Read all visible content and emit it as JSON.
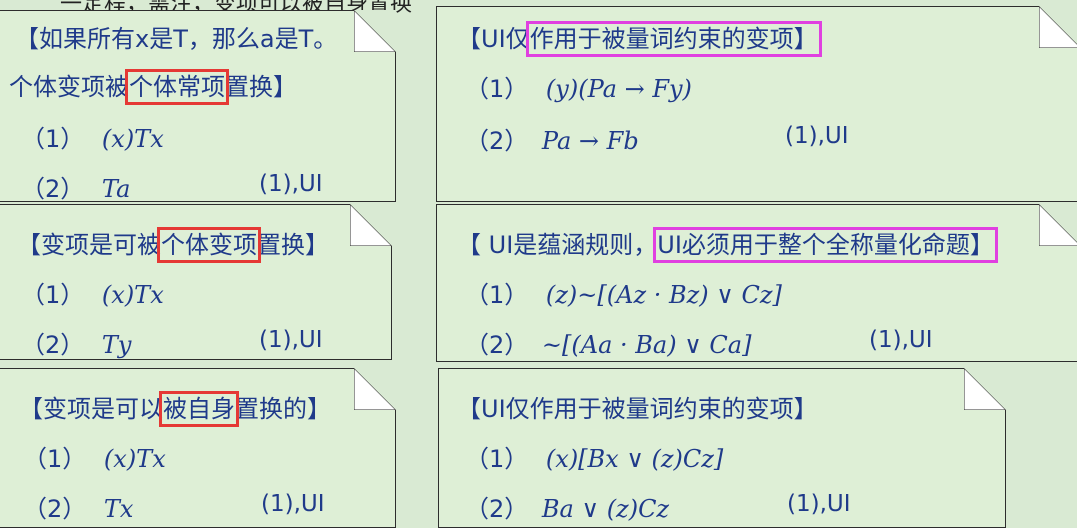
{
  "top_strip": "一定程，需注，变项可以被自身置换",
  "panels": [
    {
      "title_pre": "【如果所有x是T，那么a是T。",
      "title_line2_pre": "个体变项被",
      "title_line2_hl": "个体常项",
      "title_line2_post": "置换】",
      "steps": [
        {
          "num": "（1）",
          "formula": "(x)Tx",
          "ref": ""
        },
        {
          "num": "（2）",
          "formula": "Ta",
          "ref": "(1),UI"
        }
      ]
    },
    {
      "title_pre": "【UI仅",
      "title_hl": "作用于被量词约束的变项】",
      "title_post": "",
      "steps": [
        {
          "num": "（1）",
          "formula": "(y)(Pa → Fy)",
          "ref": ""
        },
        {
          "num": "（2）",
          "formula": "Pa → Fb",
          "ref": "(1),UI"
        }
      ]
    },
    {
      "title_pre": "【变项是可被",
      "title_hl": "个体变项",
      "title_post": "置换】",
      "steps": [
        {
          "num": "（1）",
          "formula": "(x)Tx",
          "ref": ""
        },
        {
          "num": "（2）",
          "formula": "Ty",
          "ref": "(1),UI"
        }
      ]
    },
    {
      "title_pre": "【 UI是蕴涵规则，",
      "title_hl": "UI必须用于整个全称量化命题】",
      "title_post": "",
      "steps": [
        {
          "num": "（1）",
          "formula": "(z)~[(Az · Bz) ∨ Cz]",
          "ref": ""
        },
        {
          "num": "（2）",
          "formula": "~[(Aa · Ba) ∨ Ca]",
          "ref": "(1),UI"
        }
      ]
    },
    {
      "title_pre": "【变项是可以",
      "title_hl": "被自身",
      "title_post": "置换的】",
      "steps": [
        {
          "num": "（1）",
          "formula": "(x)Tx",
          "ref": ""
        },
        {
          "num": "（2）",
          "formula": "Tx",
          "ref": "(1),UI"
        }
      ]
    },
    {
      "title_pre": "【UI仅作用于被量词约束的变项】",
      "title_hl": "",
      "title_post": "",
      "steps": [
        {
          "num": "（1）",
          "formula": "(x)[Bx ∨ (z)Cz]",
          "ref": ""
        },
        {
          "num": "（2）",
          "formula": "Ba ∨ (z)Cz",
          "ref": "(1),UI"
        }
      ]
    }
  ]
}
